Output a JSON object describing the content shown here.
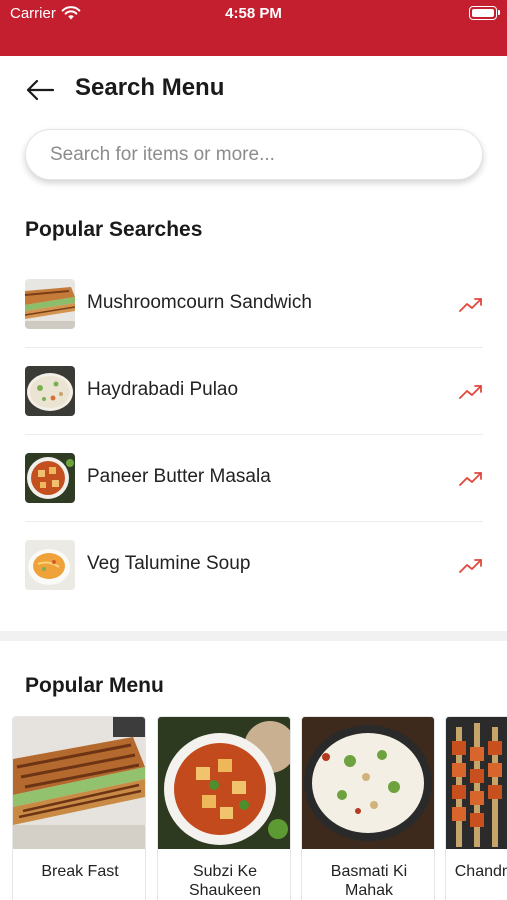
{
  "status_bar": {
    "carrier": "Carrier",
    "time": "4:58 PM"
  },
  "header": {
    "title": "Search Menu",
    "back_icon": "arrow-left-icon"
  },
  "search": {
    "placeholder": "Search for items or more...",
    "value": ""
  },
  "popular_searches": {
    "heading": "Popular Searches",
    "trend_icon": "trending-up-icon",
    "trend_color": "#e0483c",
    "items": [
      {
        "label": "Mushroomcourn Sandwich"
      },
      {
        "label": "Haydrabadi Pulao"
      },
      {
        "label": "Paneer Butter Masala"
      },
      {
        "label": "Veg Talumine Soup"
      }
    ]
  },
  "popular_menu": {
    "heading": "Popular Menu",
    "cards": [
      {
        "label": "Break Fast"
      },
      {
        "label": "Subzi Ke Shaukeen"
      },
      {
        "label": "Basmati Ki Mahak"
      },
      {
        "label": "Chandni Special"
      }
    ]
  },
  "colors": {
    "brand": "#c41f2f",
    "trend": "#e0483c"
  }
}
